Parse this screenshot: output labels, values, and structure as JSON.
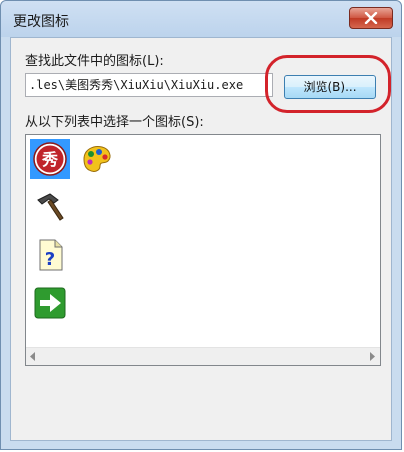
{
  "window": {
    "title": "更改图标",
    "close_glyph": "✕"
  },
  "file_section": {
    "label": "查找此文件中的图标(L):",
    "path_value": ".les\\美图秀秀\\XiuXiu\\XiuXiu.exe",
    "browse_label": "浏览(B)..."
  },
  "list_section": {
    "label": "从以下列表中选择一个图标(S):",
    "icons": [
      {
        "name": "meitu-xiu-icon",
        "glyph": "秀",
        "selected": true
      },
      {
        "name": "palette-icon",
        "selected": false
      },
      {
        "name": "hammer-icon",
        "selected": false
      },
      {
        "name": "help-document-icon",
        "glyph": "?",
        "selected": false
      },
      {
        "name": "green-arrow-icon",
        "selected": false
      }
    ]
  },
  "colors": {
    "accent_selection": "#3399ff",
    "highlight_oval": "#d3232b"
  }
}
